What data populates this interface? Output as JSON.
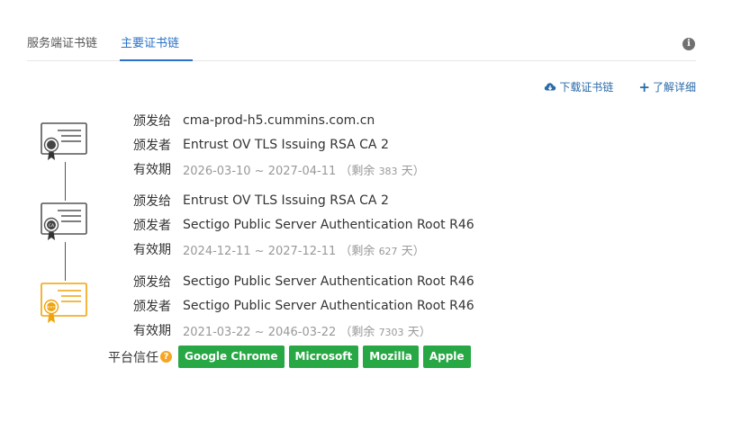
{
  "tabs": [
    {
      "label": "服务端证书链"
    },
    {
      "label": "主要证书链"
    }
  ],
  "actions": {
    "download_label": "下载证书链",
    "learn_more_label": "了解详细"
  },
  "certs": [
    {
      "issued_to_label": "颁发给",
      "issued_to": "cma-prod-h5.cummins.com.cn",
      "issuer_label": "颁发者",
      "issuer": "Entrust OV TLS Issuing RSA CA 2",
      "validity_label": "有效期",
      "validity_range": "2026-03-10 ~ 2027-04-11",
      "remaining_prefix": "（剩余",
      "remaining_days": "383",
      "remaining_suffix": "天）"
    },
    {
      "issued_to_label": "颁发给",
      "issued_to": "Entrust OV TLS Issuing RSA CA 2",
      "issuer_label": "颁发者",
      "issuer": "Sectigo Public Server Authentication Root R46",
      "validity_label": "有效期",
      "validity_range": "2024-12-11 ~ 2027-12-11",
      "remaining_prefix": "（剩余",
      "remaining_days": "627",
      "remaining_suffix": "天）"
    },
    {
      "issued_to_label": "颁发给",
      "issued_to": "Sectigo Public Server Authentication Root R46",
      "issuer_label": "颁发者",
      "issuer": "Sectigo Public Server Authentication Root R46",
      "validity_label": "有效期",
      "validity_range": "2021-03-22 ~ 2046-03-22",
      "remaining_prefix": "（剩余",
      "remaining_days": "7303",
      "remaining_suffix": "天）"
    }
  ],
  "chain_icons": [
    {
      "icon": "leaf-certificate-icon",
      "badge_text": ""
    },
    {
      "icon": "intermediate-certificate-icon",
      "badge_text": "CA"
    },
    {
      "icon": "root-certificate-icon",
      "badge_text": "ROOT"
    }
  ],
  "trust": {
    "label": "平台信任",
    "platforms": [
      "Google Chrome",
      "Microsoft",
      "Mozilla",
      "Apple"
    ]
  },
  "colors": {
    "accent": "#2a73c6",
    "link": "#2a6aa8",
    "trust_green": "#28a745",
    "root_gold": "#f0a30a",
    "help_orange": "#f5a623"
  }
}
